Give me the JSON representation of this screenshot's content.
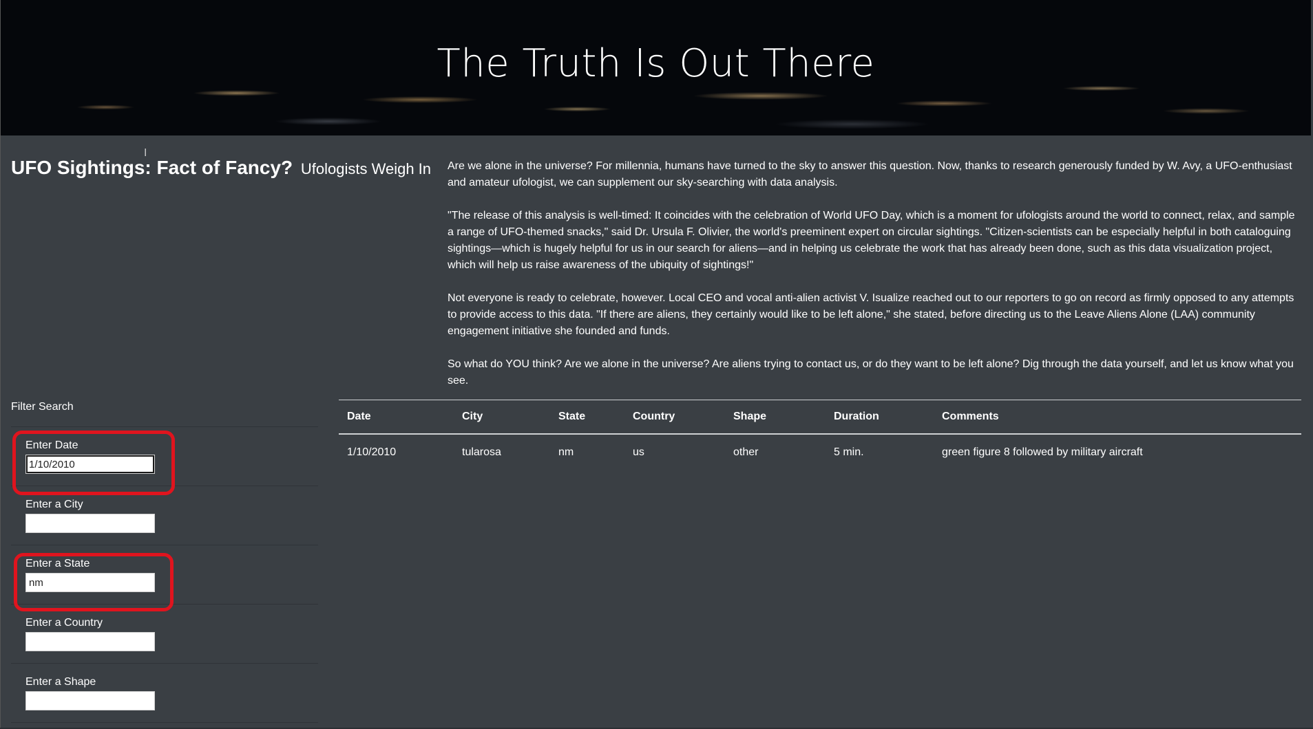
{
  "hero": {
    "title": "The Truth Is Out There"
  },
  "heading": {
    "main": "UFO Sightings: Fact of Fancy?",
    "sub": "Ufologists Weigh In"
  },
  "article": {
    "paragraphs": [
      "Are we alone in the universe? For millennia, humans have turned to the sky to answer this question. Now, thanks to research generously funded by W. Avy, a UFO-enthusiast and amateur ufologist, we can supplement our sky-searching with data analysis.",
      "\"The release of this analysis is well-timed: It coincides with the celebration of World UFO Day, which is a moment for ufologists around the world to connect, relax, and sample a range of UFO-themed snacks,\" said Dr. Ursula F. Olivier, the world's preeminent expert on circular sightings. \"Citizen-scientists can be especially helpful in both cataloguing sightings—which is hugely helpful for us in our search for aliens—and in helping us celebrate the work that has already been done, such as this data visualization project, which will help us raise awareness of the ubiquity of sightings!\"",
      "Not everyone is ready to celebrate, however. Local CEO and vocal anti-alien activist V. Isualize reached out to our reporters to go on record as firmly opposed to any attempts to provide access to this data. \"If there are aliens, they certainly would like to be left alone,\" she stated, before directing us to the Leave Aliens Alone (LAA) community engagement initiative she founded and funds.",
      "So what do YOU think? Are we alone in the universe? Are aliens trying to contact us, or do they want to be left alone? Dig through the data yourself, and let us know what you see."
    ]
  },
  "filters": {
    "title": "Filter Search",
    "items": [
      {
        "label": "Enter Date",
        "value": "1/10/2010"
      },
      {
        "label": "Enter a City",
        "value": ""
      },
      {
        "label": "Enter a State",
        "value": "nm"
      },
      {
        "label": "Enter a Country",
        "value": ""
      },
      {
        "label": "Enter a Shape",
        "value": ""
      }
    ]
  },
  "table": {
    "headers": [
      "Date",
      "City",
      "State",
      "Country",
      "Shape",
      "Duration",
      "Comments"
    ],
    "rows": [
      [
        "1/10/2010",
        "tularosa",
        "nm",
        "us",
        "other",
        "5 min.",
        "green figure 8 followed by military aircraft"
      ]
    ]
  },
  "colors": {
    "background": "#3a3f44",
    "highlight": "#e0141e"
  }
}
